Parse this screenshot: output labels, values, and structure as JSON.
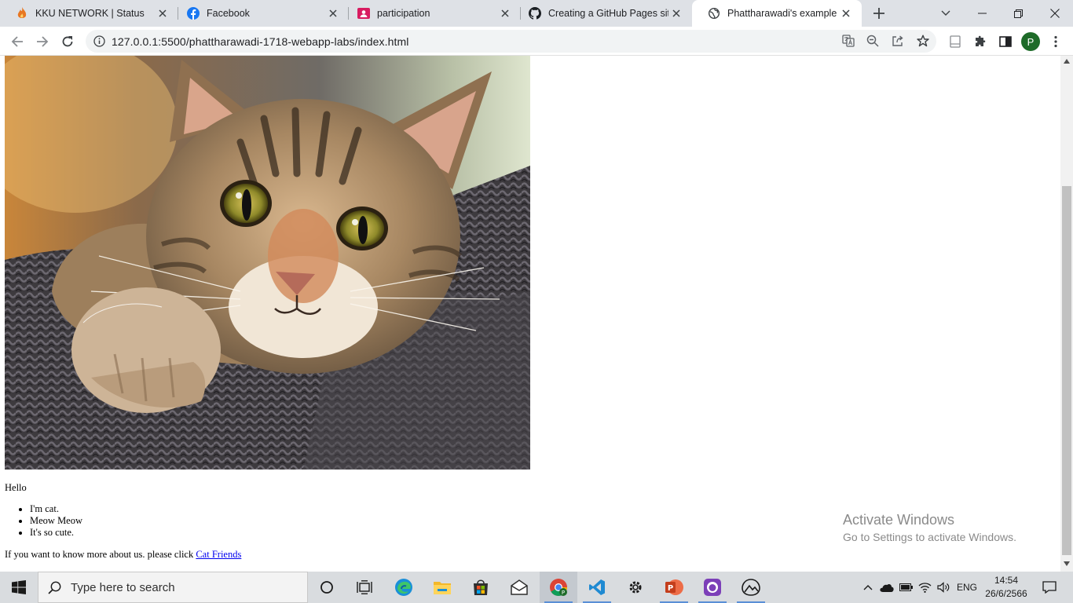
{
  "browser": {
    "tabs": [
      {
        "title": "KKU NETWORK | Status",
        "favicon": "kku-flame-icon"
      },
      {
        "title": "Facebook",
        "favicon": "facebook-icon"
      },
      {
        "title": "participation",
        "favicon": "classroom-icon"
      },
      {
        "title": "Creating a GitHub Pages site",
        "favicon": "github-icon"
      },
      {
        "title": "Phattharawadi's example pag",
        "favicon": "globe-icon"
      }
    ],
    "active_tab_index": 4,
    "url": "127.0.0.1:5500/phattharawadi-1718-webapp-labs/index.html",
    "profile_initial": "P"
  },
  "page": {
    "image_subject": "tabby cat on knitted blanket",
    "hello": "Hello",
    "list_items": [
      "I'm cat.",
      "Meow Meow",
      "It's so cute."
    ],
    "more_text": "If you want to know more about us. please click ",
    "link_text": "Cat Friends"
  },
  "watermark": {
    "line1": "Activate Windows",
    "line2": "Go to Settings to activate Windows."
  },
  "taskbar": {
    "search_placeholder": "Type here to search",
    "language": "ENG",
    "time": "14:54",
    "date": "26/6/2566"
  },
  "colors": {
    "tabstrip": "#dee1e6",
    "link": "#0000ee",
    "avatar": "#1e6b29",
    "taskbar": "#d9dcdf"
  }
}
